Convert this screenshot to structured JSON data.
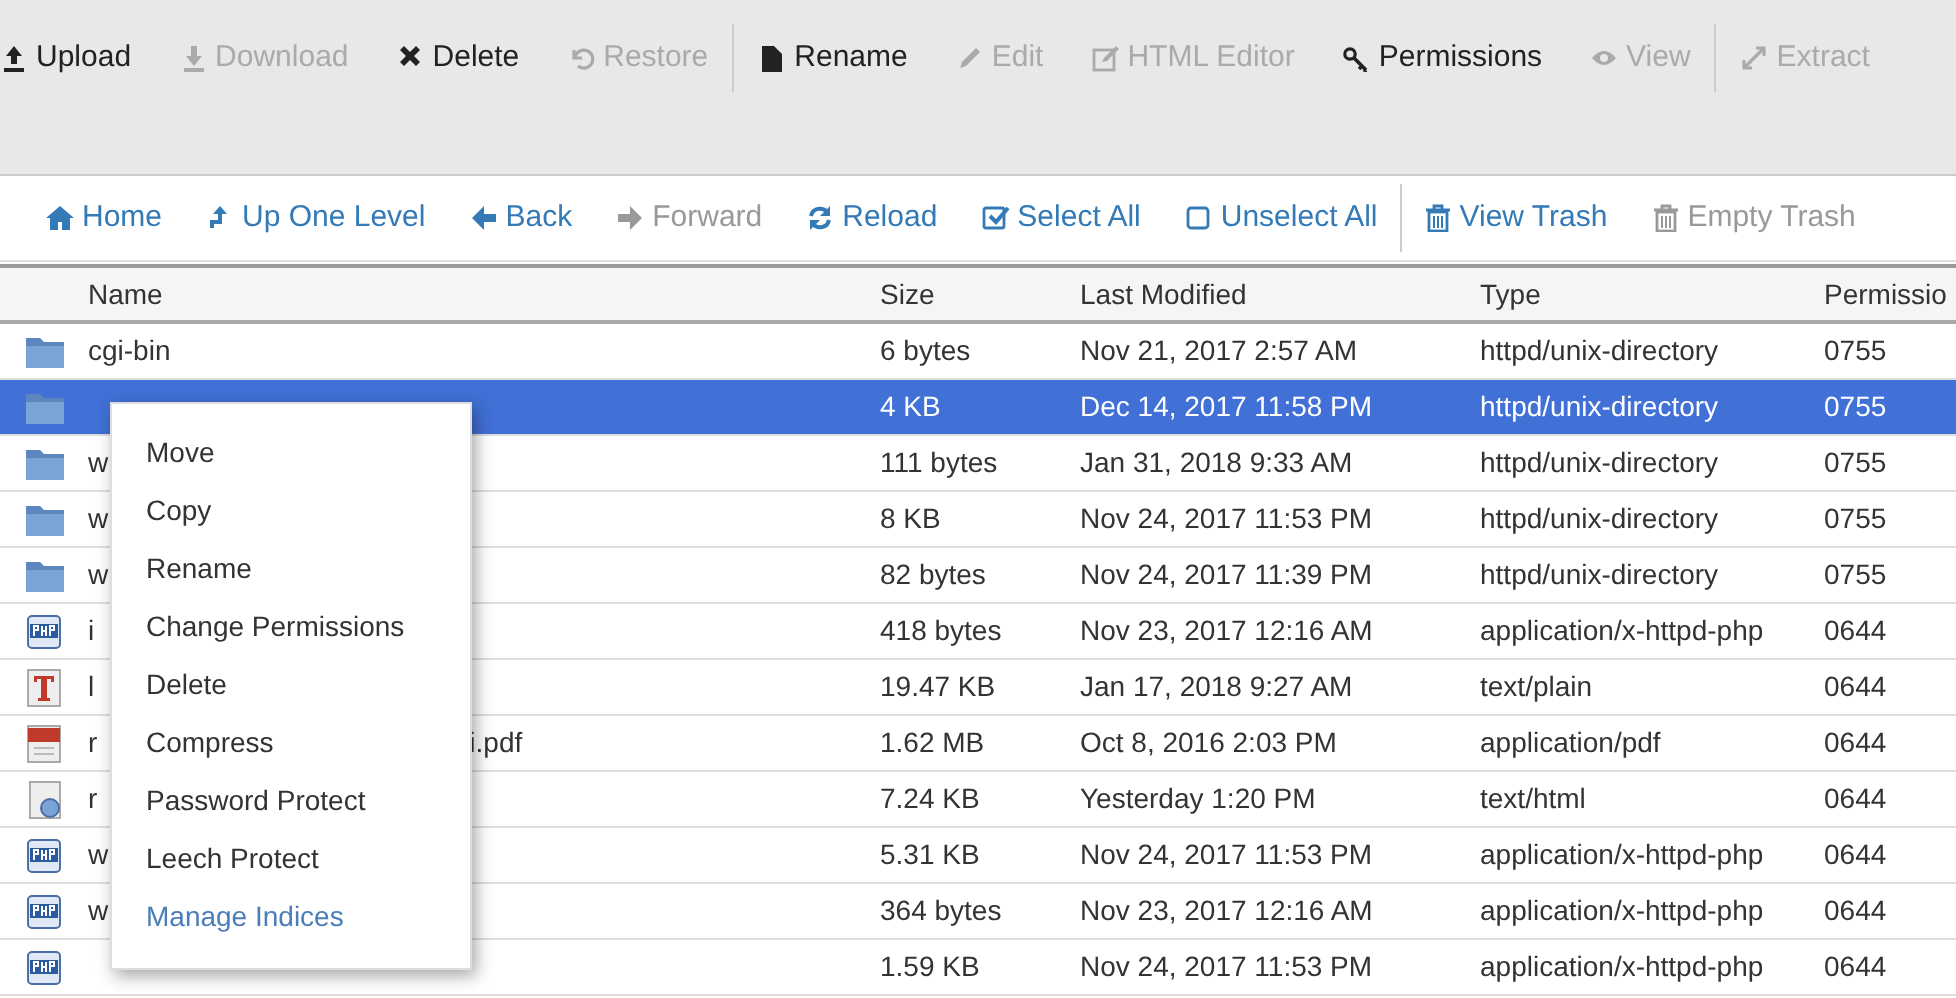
{
  "toolbar": [
    {
      "label": "Upload",
      "disabled": false
    },
    {
      "label": "Download",
      "disabled": true
    },
    {
      "label": "Delete",
      "disabled": false
    },
    {
      "label": "Restore",
      "disabled": true
    },
    {
      "label": "Rename",
      "disabled": false
    },
    {
      "label": "Edit",
      "disabled": true
    },
    {
      "label": "HTML Editor",
      "disabled": true
    },
    {
      "label": "Permissions",
      "disabled": false
    },
    {
      "label": "View",
      "disabled": true
    },
    {
      "label": "Extract",
      "disabled": true
    }
  ],
  "navbar": [
    {
      "label": "Home",
      "disabled": false
    },
    {
      "label": "Up One Level",
      "disabled": false
    },
    {
      "label": "Back",
      "disabled": false
    },
    {
      "label": "Forward",
      "disabled": true
    },
    {
      "label": "Reload",
      "disabled": false
    },
    {
      "label": "Select All",
      "disabled": false
    },
    {
      "label": "Unselect All",
      "disabled": false
    },
    {
      "label": "View Trash",
      "disabled": false
    },
    {
      "label": "Empty Trash",
      "disabled": true
    }
  ],
  "table": {
    "columns": [
      "Name",
      "Size",
      "Last Modified",
      "Type",
      "Permissio"
    ],
    "rows": [
      {
        "kind": "folder",
        "selected": false,
        "name": "cgi-bin",
        "size": "6 bytes",
        "modified": "Nov 21, 2017 2:57 AM",
        "type": "httpd/unix-directory",
        "perms": "0755"
      },
      {
        "kind": "folder",
        "selected": true,
        "size": "4 KB",
        "modified": "Dec 14, 2017 11:58 PM",
        "type": "httpd/unix-directory",
        "perms": "0755"
      },
      {
        "kind": "folder",
        "selected": false,
        "name": "w",
        "size": "111 bytes",
        "modified": "Jan 31, 2018 9:33 AM",
        "type": "httpd/unix-directory",
        "perms": "0755"
      },
      {
        "kind": "folder",
        "selected": false,
        "name": "w",
        "size": "8 KB",
        "modified": "Nov 24, 2017 11:53 PM",
        "type": "httpd/unix-directory",
        "perms": "0755"
      },
      {
        "kind": "folder",
        "selected": false,
        "name": "w",
        "size": "82 bytes",
        "modified": "Nov 24, 2017 11:39 PM",
        "type": "httpd/unix-directory",
        "perms": "0755"
      },
      {
        "kind": "php",
        "selected": false,
        "name": "i",
        "size": "418 bytes",
        "modified": "Nov 23, 2017 12:16 AM",
        "type": "application/x-httpd-php",
        "perms": "0644"
      },
      {
        "kind": "text",
        "selected": false,
        "name": "l",
        "size": "19.47 KB",
        "modified": "Jan 17, 2018 9:27 AM",
        "type": "text/plain",
        "perms": "0644"
      },
      {
        "kind": "pdf",
        "selected": false,
        "name": "r",
        "name_tail": "i.pdf",
        "size": "1.62 MB",
        "modified": "Oct 8, 2016 2:03 PM",
        "type": "application/pdf",
        "perms": "0644"
      },
      {
        "kind": "html",
        "selected": false,
        "name": "r",
        "size": "7.24 KB",
        "modified": "Yesterday 1:20 PM",
        "type": "text/html",
        "perms": "0644"
      },
      {
        "kind": "php",
        "selected": false,
        "name": "w",
        "size": "5.31 KB",
        "modified": "Nov 24, 2017 11:53 PM",
        "type": "application/x-httpd-php",
        "perms": "0644"
      },
      {
        "kind": "php",
        "selected": false,
        "name": "w",
        "size": "364 bytes",
        "modified": "Nov 23, 2017 12:16 AM",
        "type": "application/x-httpd-php",
        "perms": "0644"
      },
      {
        "kind": "php",
        "selected": false,
        "size": "1.59 KB",
        "modified": "Nov 24, 2017 11:53 PM",
        "type": "application/x-httpd-php",
        "perms": "0644"
      }
    ]
  },
  "context_menu": [
    {
      "label": "Move",
      "highlighted": false
    },
    {
      "label": "Copy",
      "highlighted": false
    },
    {
      "label": "Rename",
      "highlighted": false
    },
    {
      "label": "Change Permissions",
      "highlighted": false
    },
    {
      "label": "Delete",
      "highlighted": false
    },
    {
      "label": "Compress",
      "highlighted": false
    },
    {
      "label": "Password Protect",
      "highlighted": false
    },
    {
      "label": "Leech Protect",
      "highlighted": false
    },
    {
      "label": "Manage Indices",
      "highlighted": true
    }
  ]
}
